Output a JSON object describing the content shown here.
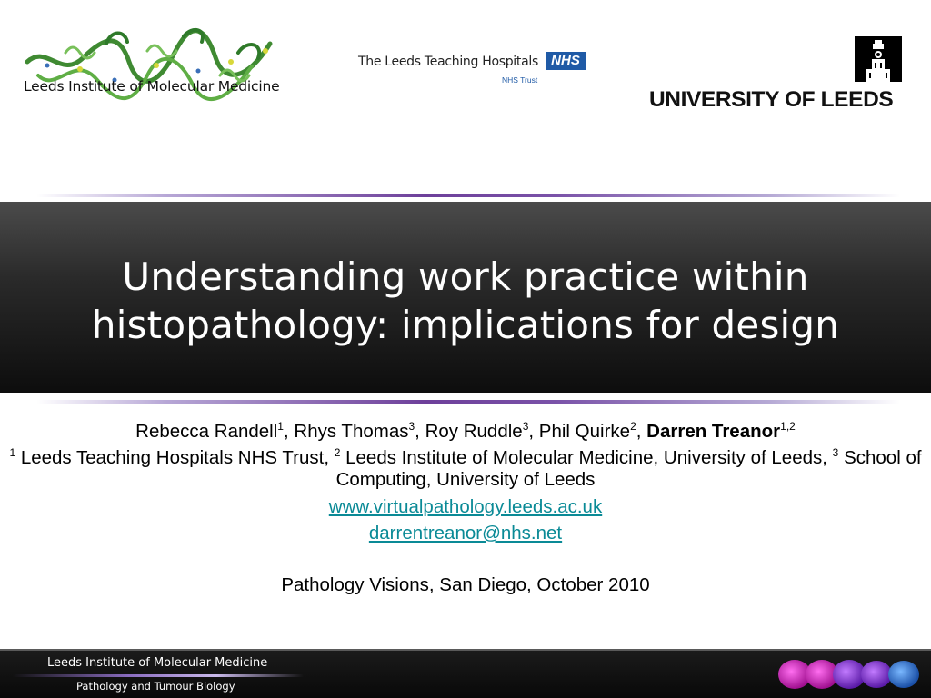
{
  "header": {
    "lime_logo_text": "Leeds Institute of Molecular Medicine",
    "ltht_name": "The Leeds Teaching Hospitals",
    "nhs_badge": "NHS",
    "nhs_trust": "NHS Trust",
    "uol_name": "UNIVERSITY OF LEEDS"
  },
  "title": {
    "line1": "Understanding work practice within",
    "line2": "histopathology: implications for design"
  },
  "authors": [
    {
      "name": "Rebecca Randell",
      "sup": "1"
    },
    {
      "name": "Rhys Thomas",
      "sup": "3"
    },
    {
      "name": "Roy Ruddle",
      "sup": "3"
    },
    {
      "name": "Phil Quirke",
      "sup": "2"
    },
    {
      "name": "Darren Treanor",
      "sup": "1,2"
    }
  ],
  "affiliations": [
    {
      "sup": "1",
      "text": "Leeds Teaching Hospitals NHS Trust,"
    },
    {
      "sup": "2",
      "text": "Leeds Institute of Molecular Medicine, University of Leeds,"
    },
    {
      "sup": "3",
      "text": "School of Computing, University of Leeds"
    }
  ],
  "website": "www.virtualpathology.leeds.ac.uk",
  "email": "darrentreanor@nhs.net",
  "event": "Pathology Visions, San Diego, October 2010",
  "footer": {
    "line1": "Leeds Institute of Molecular Medicine",
    "line2": "Pathology and Tumour Biology"
  },
  "colors": {
    "link": "#0a8a96",
    "rule_purple": "#6d3f9a",
    "nhs_blue": "#1f5aa6"
  }
}
